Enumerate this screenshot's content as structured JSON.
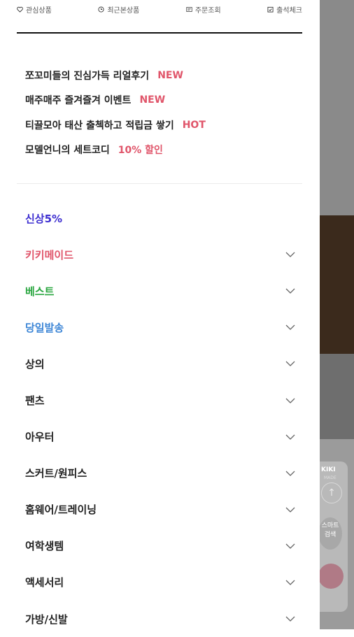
{
  "topbar": {
    "items": [
      {
        "label": "관심상품",
        "icon": "heart-icon"
      },
      {
        "label": "최근본상품",
        "icon": "clock-icon"
      },
      {
        "label": "주문조회",
        "icon": "receipt-icon"
      },
      {
        "label": "출석체크",
        "icon": "calendar-check-icon"
      }
    ]
  },
  "promos": [
    {
      "text": "쪼꼬미들의 진심가득 리얼후기",
      "badge": "NEW"
    },
    {
      "text": "매주매주 즐겨즐겨 이벤트",
      "badge": "NEW"
    },
    {
      "text": "티끌모아 태산 출첵하고 적립금 쌓기",
      "badge": "HOT"
    },
    {
      "text": "모델언니의 세트코디",
      "badge": "10% 할인"
    }
  ],
  "categories": [
    {
      "label": "신상5%",
      "color": "#3d2ed0",
      "has_submenu": false
    },
    {
      "label": "키키메이드",
      "color": "#e0556a",
      "has_submenu": true
    },
    {
      "label": "베스트",
      "color": "#2aa640",
      "has_submenu": true
    },
    {
      "label": "당일발송",
      "color": "#3d86d6",
      "has_submenu": true
    },
    {
      "label": "상의",
      "color": "#222222",
      "has_submenu": true
    },
    {
      "label": "팬츠",
      "color": "#222222",
      "has_submenu": true
    },
    {
      "label": "아우터",
      "color": "#222222",
      "has_submenu": true
    },
    {
      "label": "스커트/원피스",
      "color": "#222222",
      "has_submenu": true
    },
    {
      "label": "홈웨어/트레이닝",
      "color": "#222222",
      "has_submenu": true
    },
    {
      "label": "여학생템",
      "color": "#222222",
      "has_submenu": true
    },
    {
      "label": "액세서리",
      "color": "#222222",
      "has_submenu": true
    },
    {
      "label": "가방/신발",
      "color": "#222222",
      "has_submenu": true
    }
  ],
  "background": {
    "logo_text": "KIKI",
    "logo_sub": "MADE",
    "smart_search": "스마트\n검색"
  },
  "colors": {
    "badge": "#e0556a",
    "overlay": "#8a8a8a"
  }
}
